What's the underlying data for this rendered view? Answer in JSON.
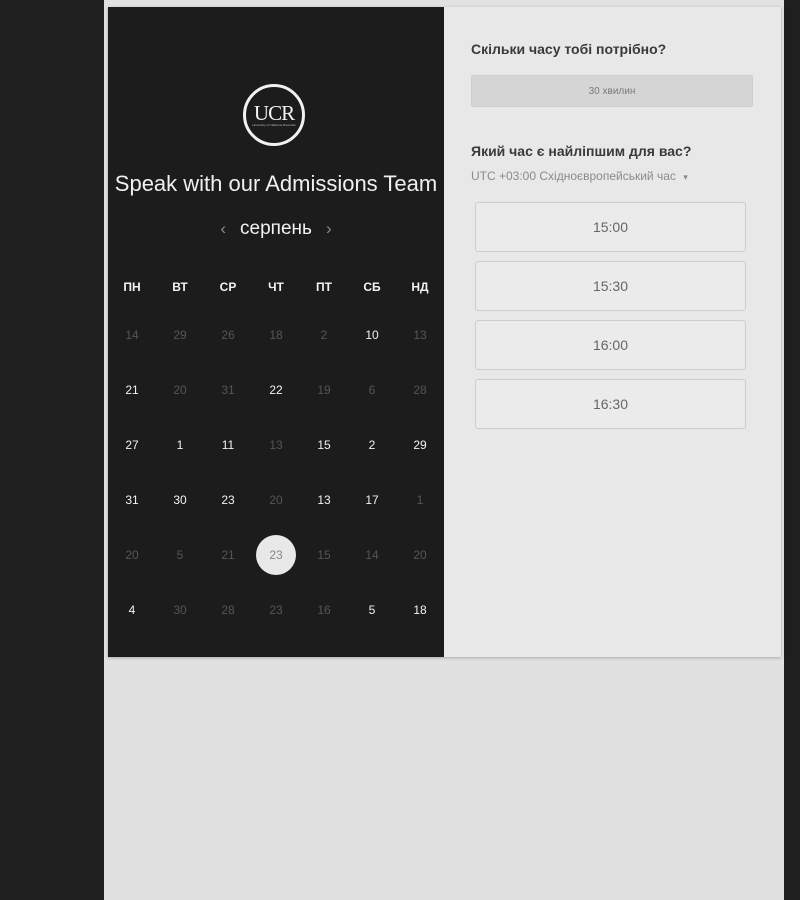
{
  "logo": {
    "text": "UCR",
    "subtext": "University of California Riverside"
  },
  "team_title": "Speak with our Admissions Team",
  "calendar": {
    "month": "серпень",
    "prev_icon": "chevron-left-icon",
    "next_icon": "chevron-right-icon",
    "weekdays": [
      "ПН",
      "ВТ",
      "СР",
      "ЧТ",
      "ПТ",
      "СБ",
      "НД"
    ],
    "rows": [
      [
        {
          "d": "14",
          "a": false
        },
        {
          "d": "29",
          "a": false
        },
        {
          "d": "26",
          "a": false
        },
        {
          "d": "18",
          "a": false
        },
        {
          "d": "2",
          "a": false
        },
        {
          "d": "10",
          "a": true
        },
        {
          "d": "13",
          "a": false
        }
      ],
      [
        {
          "d": "21",
          "a": true
        },
        {
          "d": "20",
          "a": false
        },
        {
          "d": "31",
          "a": false
        },
        {
          "d": "22",
          "a": true
        },
        {
          "d": "19",
          "a": false
        },
        {
          "d": "6",
          "a": false
        },
        {
          "d": "28",
          "a": false
        }
      ],
      [
        {
          "d": "27",
          "a": true
        },
        {
          "d": "1",
          "a": true
        },
        {
          "d": "11",
          "a": true
        },
        {
          "d": "13",
          "a": false
        },
        {
          "d": "15",
          "a": true
        },
        {
          "d": "2",
          "a": true
        },
        {
          "d": "29",
          "a": true
        }
      ],
      [
        {
          "d": "31",
          "a": true
        },
        {
          "d": "30",
          "a": true
        },
        {
          "d": "23",
          "a": true
        },
        {
          "d": "20",
          "a": false
        },
        {
          "d": "13",
          "a": true
        },
        {
          "d": "17",
          "a": true
        },
        {
          "d": "1",
          "a": false
        }
      ],
      [
        {
          "d": "20",
          "a": false
        },
        {
          "d": "5",
          "a": false
        },
        {
          "d": "21",
          "a": false
        },
        {
          "d": "23",
          "a": true,
          "selected": true
        },
        {
          "d": "15",
          "a": false
        },
        {
          "d": "14",
          "a": false
        },
        {
          "d": "20",
          "a": false
        }
      ],
      [
        {
          "d": "4",
          "a": true
        },
        {
          "d": "30",
          "a": false
        },
        {
          "d": "28",
          "a": false
        },
        {
          "d": "23",
          "a": false
        },
        {
          "d": "16",
          "a": false
        },
        {
          "d": "5",
          "a": true
        },
        {
          "d": "18",
          "a": true
        }
      ]
    ]
  },
  "duration": {
    "question": "Скільки часу тобі потрібно?",
    "value": "30 хвилин"
  },
  "time": {
    "question": "Який час є найліпшим для вас?",
    "timezone": "UTC +03:00 Східноєвропейський час",
    "dropdown_icon": "caret-down-icon",
    "slots": [
      "15:00",
      "15:30",
      "16:00",
      "16:30"
    ]
  },
  "colors": {
    "sidebar_dark": "#1f1f1f",
    "calendar_bg": "#1c1c1c",
    "panel_bg": "#e8e8e8"
  }
}
